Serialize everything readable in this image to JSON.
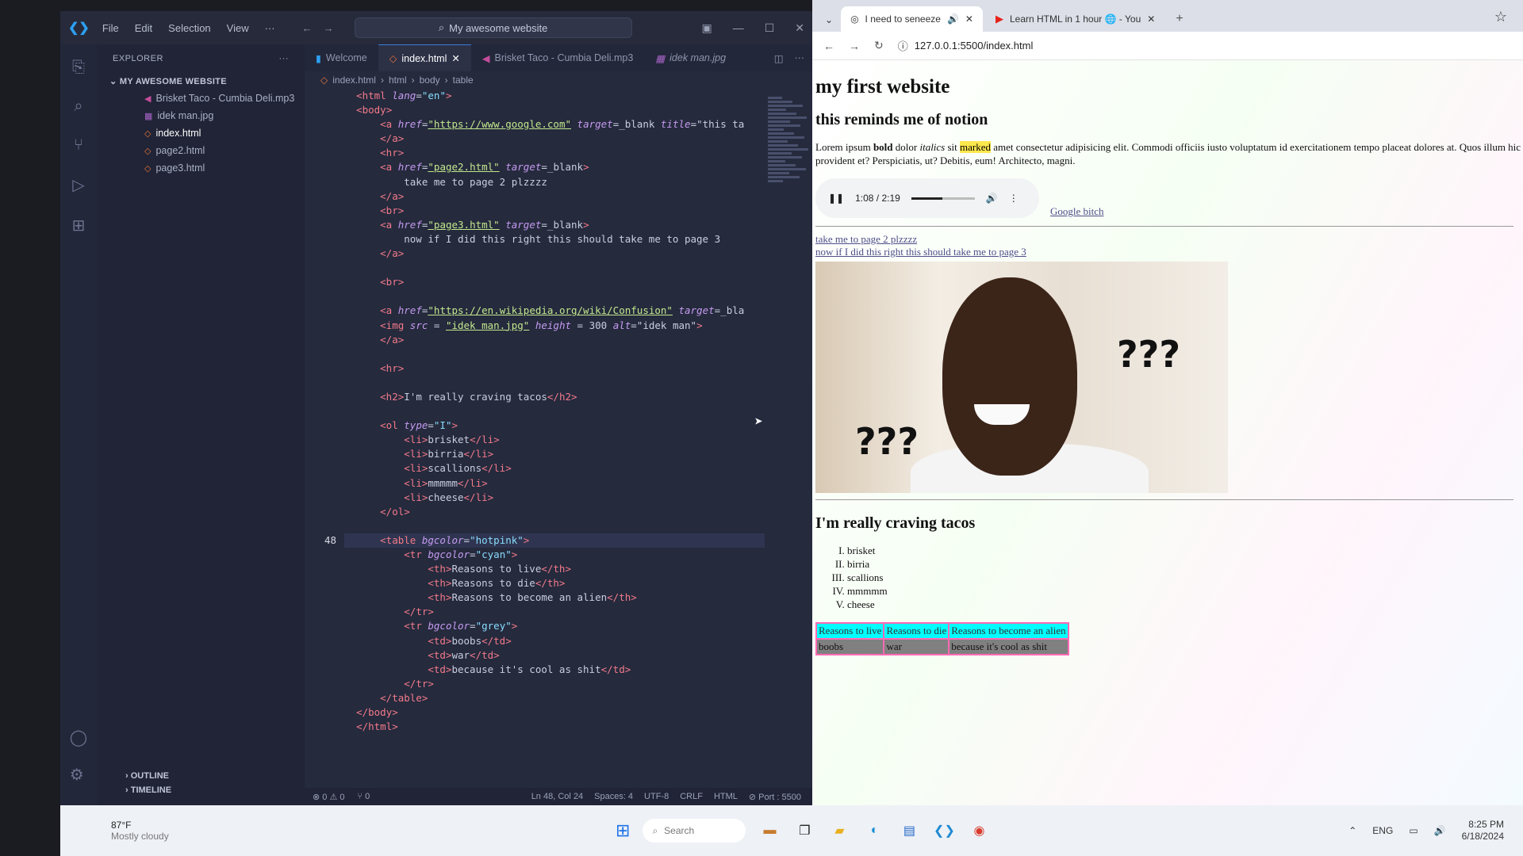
{
  "vscode": {
    "menu": [
      "File",
      "Edit",
      "Selection",
      "View",
      "···"
    ],
    "command_center": "My awesome website",
    "explorer_title": "EXPLORER",
    "folder_name": "MY AWESOME WEBSITE",
    "files": [
      {
        "name": "Brisket Taco - Cumbia Deli.mp3",
        "icon": "music-file-icon"
      },
      {
        "name": "idek man.jpg",
        "icon": "image-file-icon"
      },
      {
        "name": "index.html",
        "icon": "html-file-icon"
      },
      {
        "name": "page2.html",
        "icon": "html-file-icon"
      },
      {
        "name": "page3.html",
        "icon": "html-file-icon"
      }
    ],
    "panels": [
      "OUTLINE",
      "TIMELINE"
    ],
    "tabs": [
      "Welcome",
      "index.html",
      "Brisket Taco - Cumbia Deli.mp3",
      "idek man.jpg"
    ],
    "breadcrumb": [
      "index.html",
      "html",
      "body",
      "table"
    ],
    "status": {
      "problems": "⊗ 0 ⚠ 0",
      "ports": "⑂ 0",
      "position": "Ln 48, Col 24",
      "spaces": "Spaces: 4",
      "encoding": "UTF-8",
      "eol": "CRLF",
      "language": "HTML",
      "port": "⊘ Port : 5500"
    },
    "current_line": "48",
    "code_lines": [
      {
        "html": "  <span class='t'>&lt;html</span> <span class='a'>lang</span>=<span class='p'>\"en\"</span><span class='t'>&gt;</span>"
      },
      {
        "html": "  <span class='t'>&lt;body&gt;</span>"
      },
      {
        "html": "      <span class='t'>&lt;a</span> <span class='a'>href</span>=<span class='s'>\"https://www.google.com\"</span> <span class='a'>target</span>=_blank <span class='a'>title</span>=\"this ta"
      },
      {
        "html": "      <span class='t'>&lt;/a&gt;</span>"
      },
      {
        "html": "      <span class='t'>&lt;hr&gt;</span>"
      },
      {
        "html": "      <span class='t'>&lt;a</span> <span class='a'>href</span>=<span class='s'>\"page2.html\"</span> <span class='a'>target</span>=_blank<span class='t'>&gt;</span>"
      },
      {
        "html": "          take me to page 2 plzzzz"
      },
      {
        "html": "      <span class='t'>&lt;/a&gt;</span>"
      },
      {
        "html": "      <span class='t'>&lt;br&gt;</span>"
      },
      {
        "html": "      <span class='t'>&lt;a</span> <span class='a'>href</span>=<span class='s'>\"page3.html\"</span> <span class='a'>target</span>=_blank<span class='t'>&gt;</span>"
      },
      {
        "html": "          now if I did this right this should take me to page 3"
      },
      {
        "html": "      <span class='t'>&lt;/a&gt;</span>"
      },
      {
        "html": ""
      },
      {
        "html": "      <span class='t'>&lt;br&gt;</span>"
      },
      {
        "html": ""
      },
      {
        "html": "      <span class='t'>&lt;a</span> <span class='a'>href</span>=<span class='s'>\"https://en.wikipedia.org/wiki/Confusion\"</span> <span class='a'>target</span>=_bla"
      },
      {
        "html": "      <span class='t'>&lt;img</span> <span class='a'>src</span> = <span class='s'>\"idek man.jpg\"</span> <span class='a'>height</span> = 300 <span class='a'>alt</span>=\"idek man\"<span class='t'>&gt;</span>"
      },
      {
        "html": "      <span class='t'>&lt;/a&gt;</span>"
      },
      {
        "html": ""
      },
      {
        "html": "      <span class='t'>&lt;hr&gt;</span>"
      },
      {
        "html": ""
      },
      {
        "html": "      <span class='t'>&lt;h2&gt;</span>I'm really craving tacos<span class='t'>&lt;/h2&gt;</span>"
      },
      {
        "html": ""
      },
      {
        "html": "      <span class='t'>&lt;ol</span> <span class='a'>type</span>=<span class='p'>\"I\"</span><span class='t'>&gt;</span>"
      },
      {
        "html": "          <span class='t'>&lt;li&gt;</span>brisket<span class='t'>&lt;/li&gt;</span>"
      },
      {
        "html": "          <span class='t'>&lt;li&gt;</span>birria<span class='t'>&lt;/li&gt;</span>"
      },
      {
        "html": "          <span class='t'>&lt;li&gt;</span>scallions<span class='t'>&lt;/li&gt;</span>"
      },
      {
        "html": "          <span class='t'>&lt;li&gt;</span>mmmmm<span class='t'>&lt;/li&gt;</span>"
      },
      {
        "html": "          <span class='t'>&lt;li&gt;</span>cheese<span class='t'>&lt;/li&gt;</span>"
      },
      {
        "html": "      <span class='t'>&lt;/ol&gt;</span>"
      },
      {
        "html": ""
      },
      {
        "html": "      <span class='t'>&lt;table</span> <span class='a'>bgcolor</span>=<span class='p'>\"hotpink\"</span><span class='t'>&gt;</span>",
        "current": true
      },
      {
        "html": "          <span class='t'>&lt;tr</span> <span class='a'>bgcolor</span>=<span class='p'>\"cyan\"</span><span class='t'>&gt;</span>"
      },
      {
        "html": "              <span class='t'>&lt;th&gt;</span>Reasons to live<span class='t'>&lt;/th&gt;</span>"
      },
      {
        "html": "              <span class='t'>&lt;th&gt;</span>Reasons to die<span class='t'>&lt;/th&gt;</span>"
      },
      {
        "html": "              <span class='t'>&lt;th&gt;</span>Reasons to become an alien<span class='t'>&lt;/th&gt;</span>"
      },
      {
        "html": "          <span class='t'>&lt;/tr&gt;</span>"
      },
      {
        "html": "          <span class='t'>&lt;tr</span> <span class='a'>bgcolor</span>=<span class='p'>\"grey\"</span><span class='t'>&gt;</span>"
      },
      {
        "html": "              <span class='t'>&lt;td&gt;</span>boobs<span class='t'>&lt;/td&gt;</span>"
      },
      {
        "html": "              <span class='t'>&lt;td&gt;</span>war<span class='t'>&lt;/td&gt;</span>"
      },
      {
        "html": "              <span class='t'>&lt;td&gt;</span>because it's cool as shit<span class='t'>&lt;/td&gt;</span>"
      },
      {
        "html": "          <span class='t'>&lt;/tr&gt;</span>"
      },
      {
        "html": "      <span class='t'>&lt;/table&gt;</span>"
      },
      {
        "html": "  <span class='t'>&lt;/body&gt;</span>"
      },
      {
        "html": "  <span class='t'>&lt;/html&gt;</span>"
      }
    ]
  },
  "browser": {
    "tabs": [
      {
        "title": "I need to seneeze",
        "active": true
      },
      {
        "title": "Learn HTML in 1 hour 🌐 - You",
        "active": false
      }
    ],
    "url": "127.0.0.1:5500/index.html",
    "page": {
      "h1": "my first website",
      "subtitle": "this reminds me of notion",
      "lorem": {
        "part1": "Lorem ipsum ",
        "bold": "bold",
        "part2": " dolor ",
        "italic": "italics",
        "part3": " sit ",
        "marked": "marked",
        "part4": " amet consectetur adipisicing elit. Commodi officiis iusto voluptatum id exercitationem tempo placeat dolores at. Quos illum hic provident et? Perspiciatis, ut? Debitis, eum! Architecto, magni."
      },
      "audio": {
        "time": "1:08 / 2:19",
        "progress": 0.49
      },
      "google_link": "Google bitch",
      "link_page2": "take me to page 2 plzzzz",
      "link_page3": "now if I did this right this should take me to page 3",
      "meme_text": "???",
      "tacos_heading": "I'm really craving tacos",
      "tacos": [
        "brisket",
        "birria",
        "scallions",
        "mmmmm",
        "cheese"
      ],
      "table_headers": [
        "Reasons to live",
        "Reasons to die",
        "Reasons to become an alien"
      ],
      "table_row": [
        "boobs",
        "war",
        "because it's cool as shit"
      ]
    }
  },
  "taskbar": {
    "weather_temp": "87°F",
    "weather_cond": "Mostly cloudy",
    "search_placeholder": "Search",
    "lang": "ENG",
    "time": "8:25 PM",
    "date": "6/18/2024"
  }
}
